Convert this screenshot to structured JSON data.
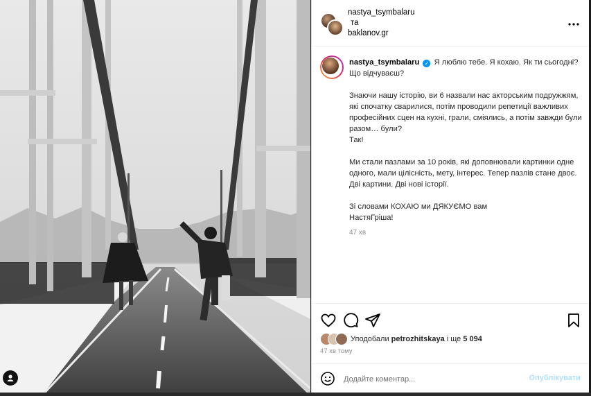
{
  "header": {
    "user1": "nastya_tsymbalaru",
    "connector": "та",
    "user2": "baklanov.gr",
    "more_icon": "more-horizontal-icon"
  },
  "caption": {
    "username": "nastya_tsymbalaru",
    "verified_icon": "verified-badge-icon",
    "line1": "Я люблю тебе. Я кохаю. Як ти сьогодні? Що відчуваєш?",
    "para1": "Знаючи нашу історію, ви 6 назвали нас акторським подружжям, які спочатку сварилися, потім проводили репетиції важливих професійних сцен на кухні, грали, сміялись, а потім завжди були разом… були?",
    "para1_end": "Так!",
    "para2": "Ми стали пазлами за 10 років, які доповнювали картинки одне одного, мали цілісність, мету, інтерес. Тепер пазлів стане двоє. Дві картини. Дві нові історії.",
    "para3_line1": "Зі словами КОХАЮ ми ДЯКУЄМО вам",
    "para3_line2": "НастяГріша!",
    "time": "47 хв"
  },
  "actions": {
    "like_icon": "heart-icon",
    "comment_icon": "comment-icon",
    "share_icon": "share-icon",
    "save_icon": "bookmark-icon"
  },
  "likes": {
    "prefix": "Уподобали",
    "user": "petrozhitskaya",
    "middle": "і ще",
    "count": "5 094"
  },
  "post_time": "47 хв тому",
  "comment": {
    "emoji_icon": "emoji-icon",
    "placeholder": "Додайте коментар...",
    "publish_label": "Опублікувати"
  },
  "photo": {
    "tag_icon": "user-tag-icon"
  },
  "colors": {
    "accent_blue": "#0095f6",
    "publish_disabled": "#b2dffc",
    "muted_text": "#8e8e8e"
  }
}
